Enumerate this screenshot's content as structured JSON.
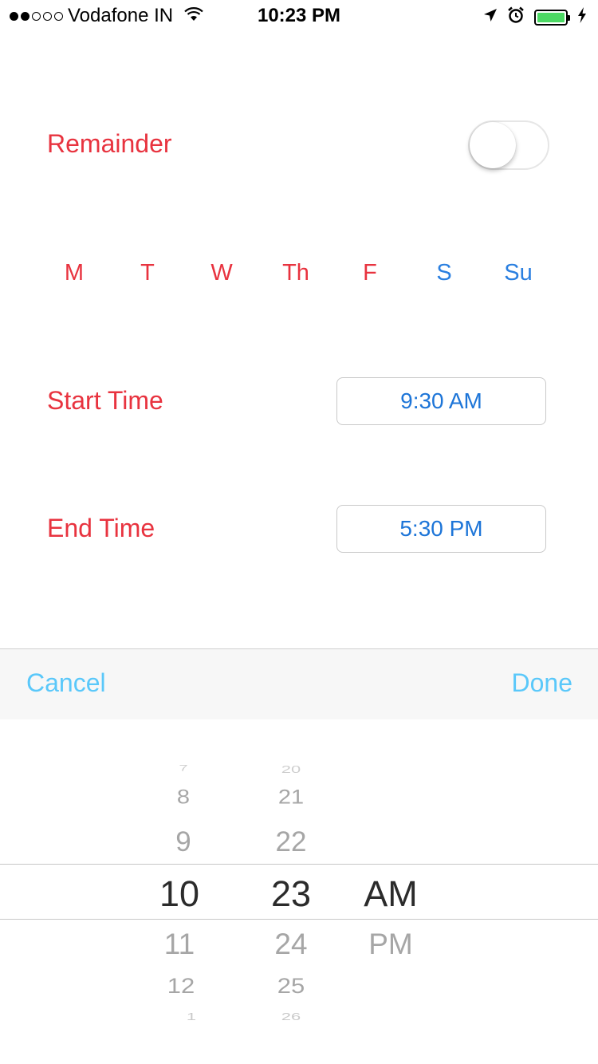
{
  "status_bar": {
    "carrier": "Vodafone IN",
    "time": "10:23 PM",
    "battery_color": "#4cd964"
  },
  "reminder": {
    "label": "Remainder",
    "toggle_on": false
  },
  "days": {
    "items": [
      {
        "label": "M",
        "type": "weekday"
      },
      {
        "label": "T",
        "type": "weekday"
      },
      {
        "label": "W",
        "type": "weekday"
      },
      {
        "label": "Th",
        "type": "weekday"
      },
      {
        "label": "F",
        "type": "weekday"
      },
      {
        "label": "S",
        "type": "weekend"
      },
      {
        "label": "Su",
        "type": "weekend"
      }
    ]
  },
  "start_time": {
    "label": "Start Time",
    "value": "9:30 AM"
  },
  "end_time": {
    "label": "End Time",
    "value": "5:30 PM"
  },
  "toolbar": {
    "cancel_label": "Cancel",
    "done_label": "Done"
  },
  "picker": {
    "hour": {
      "above": [
        "7",
        "8",
        "9"
      ],
      "selected": "10",
      "below": [
        "11",
        "12",
        "1"
      ]
    },
    "minute": {
      "above": [
        "20",
        "21",
        "22"
      ],
      "selected": "23",
      "below": [
        "24",
        "25",
        "26"
      ]
    },
    "period": {
      "selected": "AM",
      "below": [
        "PM"
      ]
    }
  },
  "colors": {
    "accent_red": "#e8333f",
    "accent_blue": "#2a7fe0",
    "toolbar_button": "#5ac8fa"
  }
}
